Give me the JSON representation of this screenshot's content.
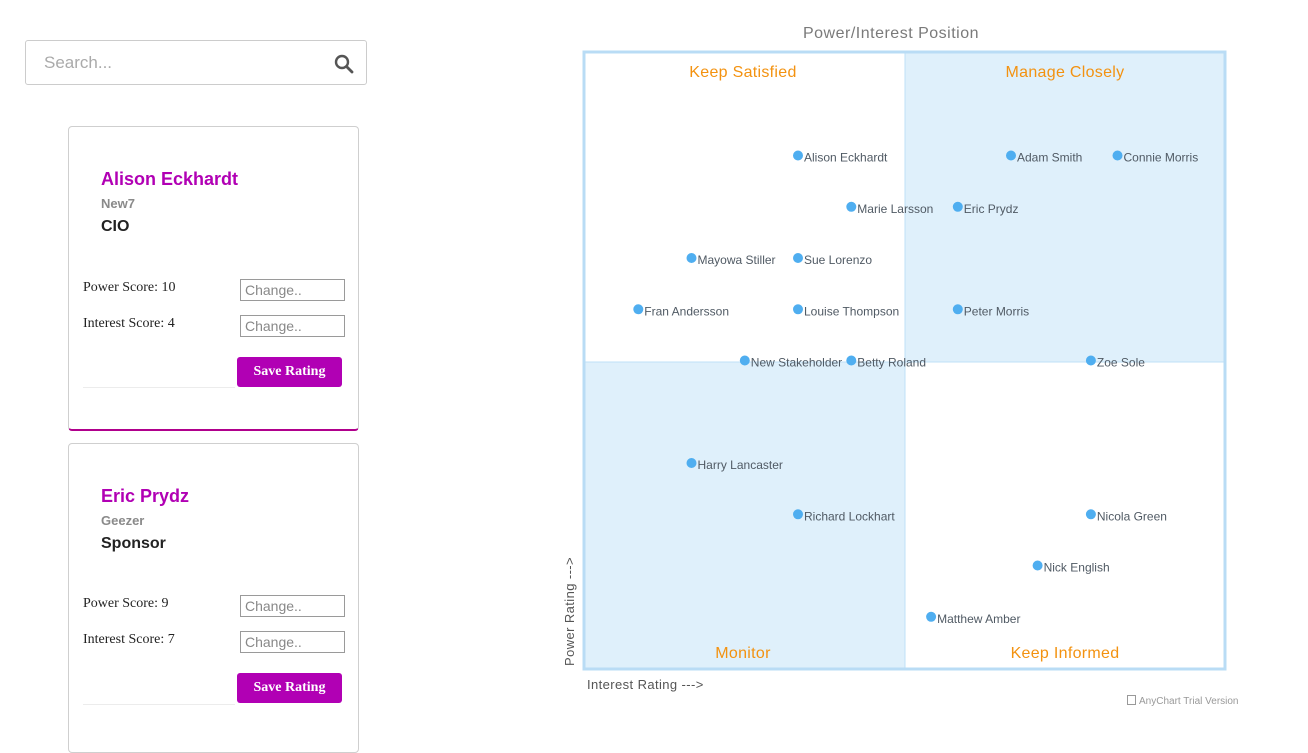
{
  "search": {
    "placeholder": "Search..."
  },
  "cards": [
    {
      "name": "Alison Eckhardt",
      "org": "New7",
      "role": "CIO",
      "power_label": "Power Score: 10",
      "interest_label": "Interest Score: 4",
      "input_placeholder": "Change..",
      "save_label": "Save Rating",
      "selected": true
    },
    {
      "name": "Eric Prydz",
      "org": "Geezer",
      "role": "Sponsor",
      "power_label": "Power Score: 9",
      "interest_label": "Interest Score: 7",
      "input_placeholder": "Change..",
      "save_label": "Save Rating",
      "selected": false
    }
  ],
  "chart_data": {
    "type": "scatter",
    "title": "Power/Interest Position",
    "xlabel": "Interest Rating --->",
    "ylabel": "Power Rating --->",
    "xlim": [
      0,
      12
    ],
    "ylim": [
      0,
      12
    ],
    "quadrants": {
      "top_left": "Keep Satisfied",
      "top_right": "Manage Closely",
      "bottom_left": "Monitor",
      "bottom_right": "Keep Informed"
    },
    "highlight_color": "#dff0fb",
    "point_color": "#4faef0",
    "points": [
      {
        "name": "Alison Eckhardt",
        "x": 4,
        "y": 10
      },
      {
        "name": "Adam Smith",
        "x": 8,
        "y": 10
      },
      {
        "name": "Connie Morris",
        "x": 10,
        "y": 10
      },
      {
        "name": "Marie Larsson",
        "x": 5,
        "y": 9
      },
      {
        "name": "Eric Prydz",
        "x": 7,
        "y": 9
      },
      {
        "name": "Mayowa Stiller",
        "x": 2,
        "y": 8
      },
      {
        "name": "Sue Lorenzo",
        "x": 4,
        "y": 8
      },
      {
        "name": "Fran Andersson",
        "x": 1,
        "y": 7
      },
      {
        "name": "Louise Thompson",
        "x": 4,
        "y": 7
      },
      {
        "name": "Peter Morris",
        "x": 7,
        "y": 7
      },
      {
        "name": "New Stakeholder",
        "x": 3,
        "y": 6
      },
      {
        "name": "Betty Roland",
        "x": 5,
        "y": 6
      },
      {
        "name": "Zoe Sole",
        "x": 9.5,
        "y": 6
      },
      {
        "name": "Harry Lancaster",
        "x": 2,
        "y": 4
      },
      {
        "name": "Richard Lockhart",
        "x": 4,
        "y": 3
      },
      {
        "name": "Nicola Green",
        "x": 9.5,
        "y": 3
      },
      {
        "name": "Nick English",
        "x": 8.5,
        "y": 2
      },
      {
        "name": "Matthew Amber",
        "x": 6.5,
        "y": 1
      }
    ]
  },
  "credits": {
    "text": "AnyChart Trial Version"
  }
}
